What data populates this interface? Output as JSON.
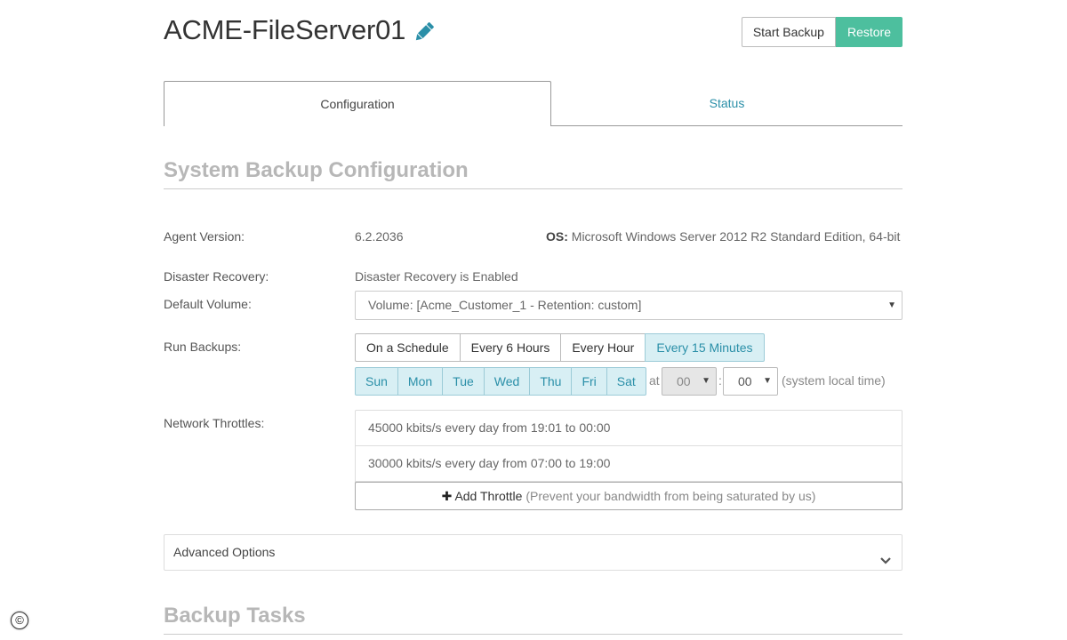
{
  "header": {
    "title": "ACME-FileServer01",
    "start_backup": "Start Backup",
    "restore": "Restore"
  },
  "tabs": [
    {
      "label": "Configuration",
      "active": true
    },
    {
      "label": "Status",
      "active": false
    }
  ],
  "section_title": "System Backup Configuration",
  "agent": {
    "label": "Agent Version:",
    "value": "6.2.2036",
    "os_label": "OS:",
    "os_value": "Microsoft Windows Server 2012 R2 Standard Edition, 64-bit"
  },
  "disaster_recovery": {
    "label": "Disaster Recovery:",
    "value": "Disaster Recovery is Enabled"
  },
  "default_volume": {
    "label": "Default Volume:",
    "value": "Volume: [Acme_Customer_1 - Retention: custom]"
  },
  "run_backups": {
    "label": "Run Backups:",
    "options": [
      "On a Schedule",
      "Every 6 Hours",
      "Every Hour",
      "Every 15 Minutes"
    ],
    "selected": "Every 15 Minutes",
    "days": [
      "Sun",
      "Mon",
      "Tue",
      "Wed",
      "Thu",
      "Fri",
      "Sat"
    ],
    "at_label": "at",
    "hour": "00",
    "minute": "00",
    "colon": ":",
    "tz_note": "(system local time)"
  },
  "network_throttles": {
    "label": "Network Throttles:",
    "rows": [
      "45000 kbits/s every day from 19:01 to 00:00",
      "30000 kbits/s every day from 07:00 to 19:00"
    ],
    "add_label": "Add Throttle",
    "add_hint": "(Prevent your bandwidth from being saturated by us)"
  },
  "advanced_options": "Advanced Options",
  "backup_tasks_title": "Backup Tasks",
  "colors": {
    "accent": "#2a8fa8",
    "restore": "#4dbf9e",
    "selected_bg": "#d8eff4"
  }
}
